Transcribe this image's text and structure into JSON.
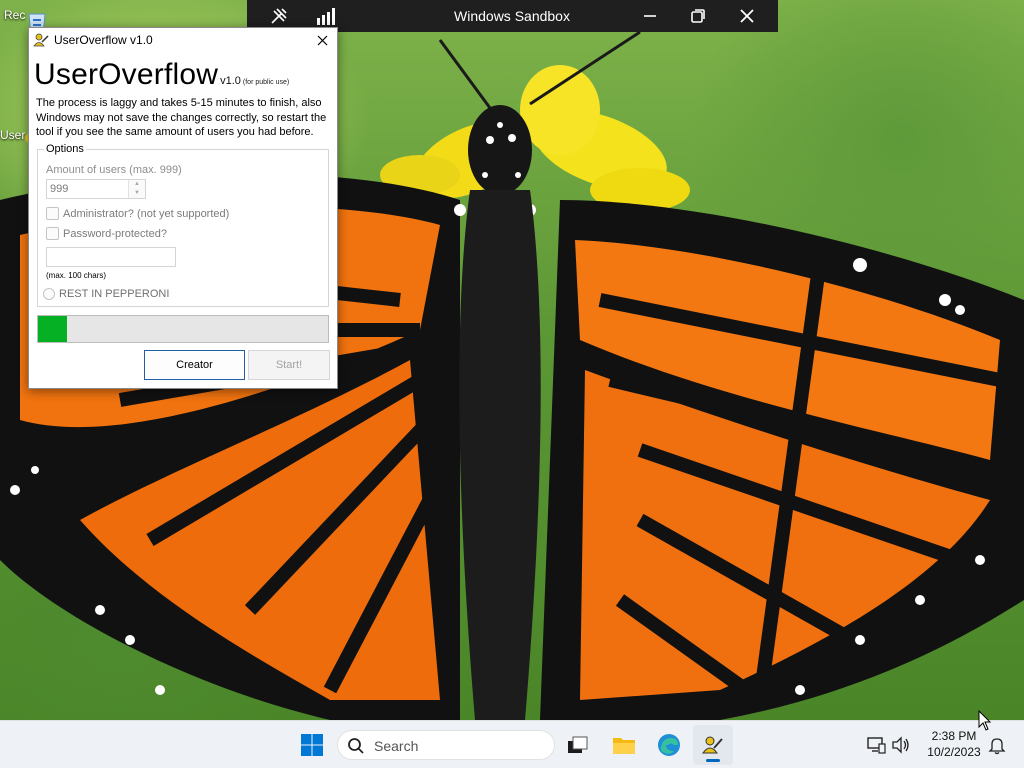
{
  "desktop": {
    "icons": [
      {
        "label": "Rec",
        "icon": "recycle-bin-icon"
      },
      {
        "label": "User",
        "icon": "useroverflow-shortcut-icon"
      }
    ]
  },
  "sandbox_bar": {
    "title": "Windows Sandbox",
    "icons": [
      "tools-icon",
      "connection-bars-icon",
      "minimize-icon",
      "restore-icon",
      "close-icon"
    ]
  },
  "app": {
    "window_title": "UserOverflow v1.0",
    "heading": "UserOverflow",
    "version": "v1.0",
    "public_note": "(for public use)",
    "description": "The process is laggy and takes 5-15 minutes to finish, also Windows may not save the changes correctly, so restart the tool if you see the same amount of users you had before.",
    "options": {
      "legend": "Options",
      "amount_label": "Amount of users (max. 999)",
      "amount_value": "999",
      "admin_label": "Administrator? (not yet supported)",
      "admin_checked": false,
      "password_label": "Password-protected?",
      "password_checked": false,
      "password_value": "",
      "max_chars_label": "(max. 100 chars)",
      "radio_label": "REST IN PEPPERONI",
      "radio_selected": false
    },
    "progress_fraction": 0.1,
    "progress_color": "#06b025",
    "buttons": {
      "creator": "Creator",
      "start": "Start!"
    }
  },
  "taskbar": {
    "search_placeholder": "Search",
    "apps": [
      "start-icon",
      "task-view-icon",
      "file-explorer-icon",
      "edge-icon",
      "useroverflow-icon"
    ],
    "tray_icons": [
      "network-icon",
      "volume-icon",
      "notifications-icon"
    ],
    "time": "2:38 PM",
    "date": "10/2/2023",
    "accent_color": "#0067c0"
  }
}
